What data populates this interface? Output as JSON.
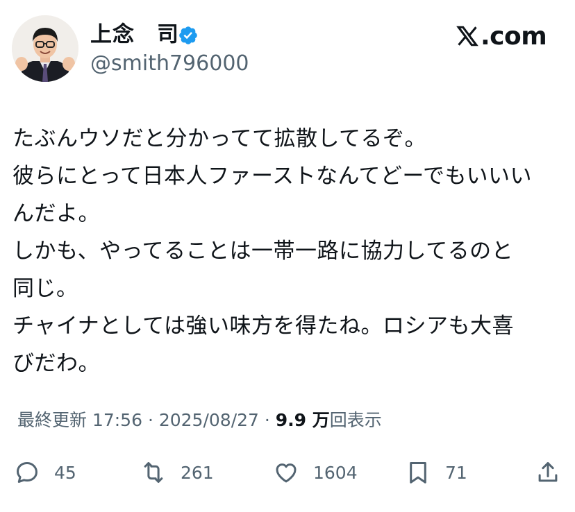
{
  "author": {
    "name": "上念　司",
    "handle": "@smith796000",
    "verified": true
  },
  "brand": {
    "text": ".com",
    "logo_icon": "x-logo-icon"
  },
  "tweet": {
    "lines": [
      "たぶんウソだと分かってて拡散してるぞ。",
      "彼らにとって日本人ファーストなんてどーでもいいい",
      "んだよ。",
      "しかも、やってることは一帯一路に協力してるのと",
      "同じ。",
      "チャイナとしては強い味方を得たね。ロシアも大喜",
      "びだわ。"
    ]
  },
  "meta": {
    "updated_label": "最終更新 17:56 · 2025/08/27  ·",
    "views_count": "9.9 万",
    "views_label": "回表示"
  },
  "actions": {
    "replies": "45",
    "retweets": "261",
    "likes": "1604",
    "bookmarks": "71"
  },
  "colors": {
    "verified_badge": "#1d9bf0",
    "secondary_text": "#536471",
    "primary_text": "#0f1419"
  }
}
